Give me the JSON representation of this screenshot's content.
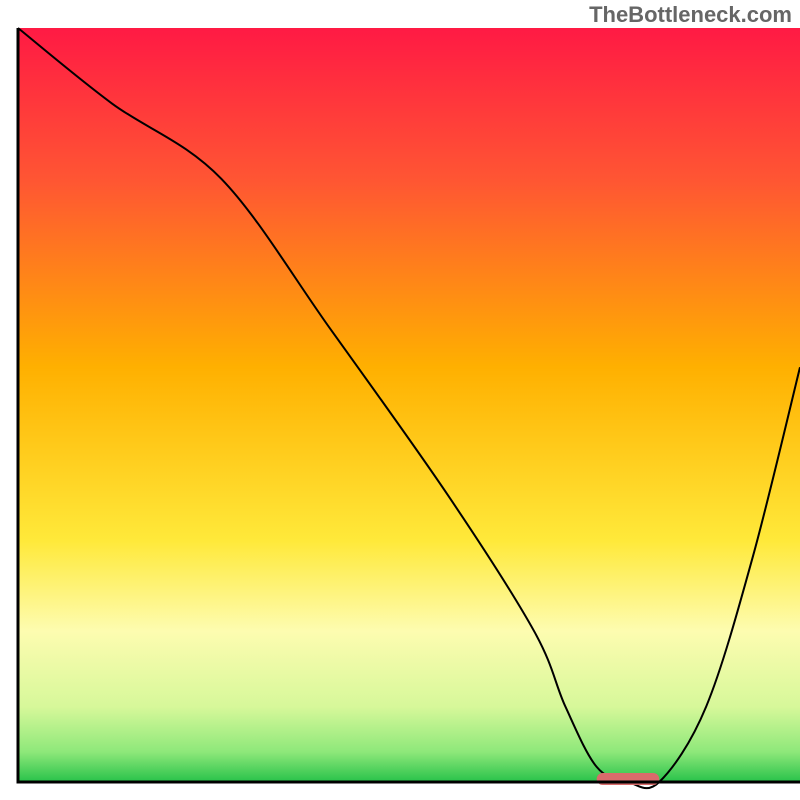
{
  "watermark": "TheBottleneck.com",
  "chart_data": {
    "type": "line",
    "title": "",
    "xlabel": "",
    "ylabel": "",
    "xlim": [
      0,
      100
    ],
    "ylim": [
      0,
      100
    ],
    "annotations": [],
    "background": {
      "description": "vertical red→yellow→light-yellow→green gradient plot area with white page border",
      "stops": [
        {
          "offset": 0.0,
          "color": "#ff1a44"
        },
        {
          "offset": 0.2,
          "color": "#ff5533"
        },
        {
          "offset": 0.45,
          "color": "#ffb000"
        },
        {
          "offset": 0.68,
          "color": "#ffe93a"
        },
        {
          "offset": 0.8,
          "color": "#fdfcb0"
        },
        {
          "offset": 0.9,
          "color": "#d7f89a"
        },
        {
          "offset": 0.96,
          "color": "#8ee87a"
        },
        {
          "offset": 1.0,
          "color": "#28c24a"
        }
      ]
    },
    "series": [
      {
        "name": "bottleneck-curve",
        "color": "#000000",
        "stroke_width": 2,
        "x": [
          0,
          12,
          26,
          40,
          55,
          66,
          70,
          74,
          78,
          82,
          88,
          94,
          100
        ],
        "y": [
          100,
          90,
          80,
          60,
          38,
          20,
          10,
          2,
          0,
          0,
          10,
          30,
          55
        ]
      }
    ],
    "optimal_marker": {
      "description": "rounded bar on x-axis marking optimal zone",
      "x_center": 78,
      "width": 8,
      "color": "#d96b6b"
    },
    "axis_frame": {
      "color": "#000000",
      "stroke_width": 3
    }
  }
}
